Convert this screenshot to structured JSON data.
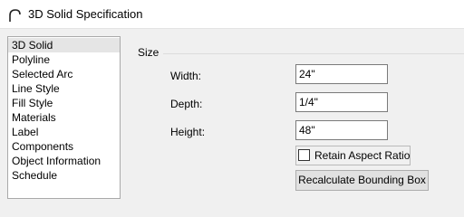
{
  "window": {
    "title": "3D Solid Specification",
    "icon": "arc-icon"
  },
  "sidebar": {
    "items": [
      {
        "label": "3D Solid",
        "selected": true
      },
      {
        "label": "Polyline",
        "selected": false
      },
      {
        "label": "Selected Arc",
        "selected": false
      },
      {
        "label": "Line Style",
        "selected": false
      },
      {
        "label": "Fill Style",
        "selected": false
      },
      {
        "label": "Materials",
        "selected": false
      },
      {
        "label": "Label",
        "selected": false
      },
      {
        "label": "Components",
        "selected": false
      },
      {
        "label": "Object Information",
        "selected": false
      },
      {
        "label": "Schedule",
        "selected": false
      }
    ]
  },
  "size_group": {
    "label": "Size",
    "width_label": "Width:",
    "width_value": "24\"",
    "depth_label": "Depth:",
    "depth_value": "1/4\"",
    "height_label": "Height:",
    "height_value": "48\"",
    "retain_aspect_label": "Retain Aspect Ratio",
    "retain_aspect_checked": false,
    "recalc_button_label": "Recalculate Bounding Box"
  }
}
